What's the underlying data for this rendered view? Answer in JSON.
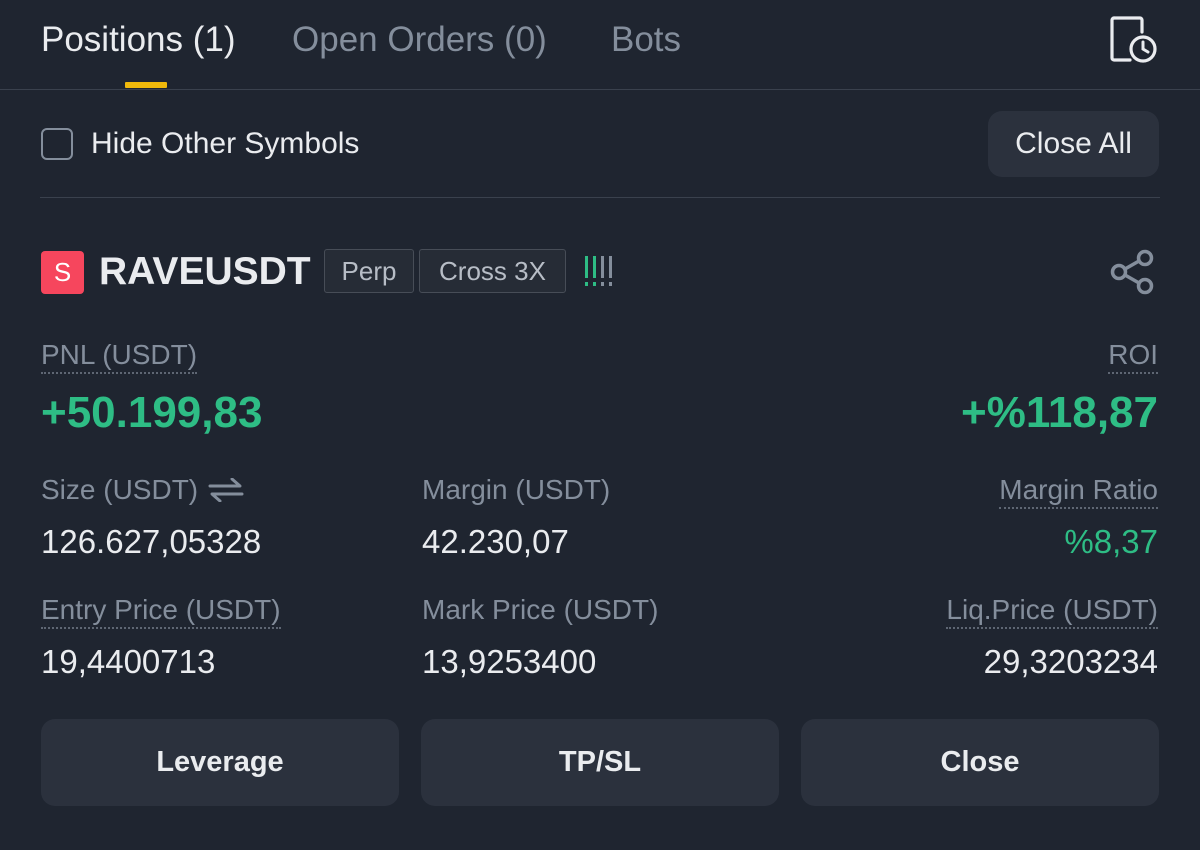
{
  "tabs": [
    {
      "label": "Positions (1)",
      "active": true
    },
    {
      "label": "Open Orders (0)",
      "active": false
    },
    {
      "label": "Bots",
      "active": false
    }
  ],
  "header_icons": {
    "history": "history-clock-icon"
  },
  "filter": {
    "hide_other_symbols_label": "Hide Other Symbols",
    "hide_other_symbols_checked": false,
    "close_all_label": "Close All"
  },
  "position": {
    "side_badge": "S",
    "symbol": "RAVEUSDT",
    "tags": [
      "Perp",
      "Cross 3X"
    ],
    "adl_level": 2,
    "share_icon": "share-icon",
    "pnl_label": "PNL (USDT)",
    "pnl_value": "+50.199,83",
    "roi_label": "ROI",
    "roi_value": "+%118,87",
    "size_label": "Size (USDT)",
    "size_value": "126.627,05328",
    "margin_label": "Margin (USDT)",
    "margin_value": "42.230,07",
    "margin_ratio_label": "Margin Ratio",
    "margin_ratio_value": "%8,37",
    "entry_price_label": "Entry Price (USDT)",
    "entry_price_value": "19,4400713",
    "mark_price_label": "Mark Price (USDT)",
    "mark_price_value": "13,9253400",
    "liq_price_label": "Liq.Price (USDT)",
    "liq_price_value": "29,3203234"
  },
  "actions": {
    "leverage": "Leverage",
    "tpsl": "TP/SL",
    "close": "Close"
  },
  "colors": {
    "background": "#1f2530",
    "accent": "#f0b90b",
    "positive": "#2ebd85",
    "short": "#f6465d"
  }
}
